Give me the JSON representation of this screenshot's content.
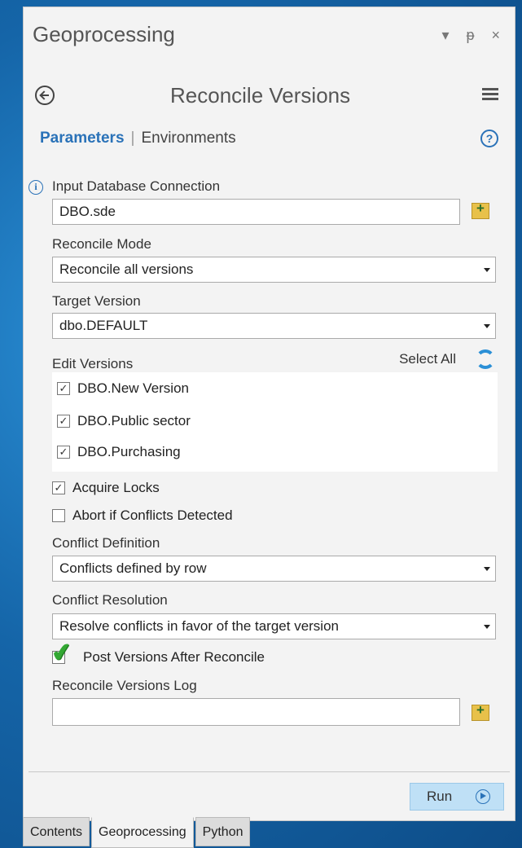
{
  "header": {
    "title": "Geoprocessing",
    "controls": "▾ ᵽ ×"
  },
  "tool": {
    "title": "Reconcile Versions"
  },
  "tabs": {
    "parameters": "Parameters",
    "separator": "|",
    "environments": "Environments"
  },
  "help_glyph": "?",
  "info_glyph": "i",
  "params": {
    "input_db": {
      "label": "Input Database Connection",
      "value": "DBO.sde"
    },
    "reconcile_mode": {
      "label": "Reconcile Mode",
      "value": "Reconcile all versions"
    },
    "target_version": {
      "label": "Target Version",
      "value": "dbo.DEFAULT"
    },
    "edit_versions": {
      "label": "Edit Versions",
      "select_all": "Select All",
      "items": [
        {
          "label": "DBO.New Version",
          "checked": "✓"
        },
        {
          "label": "DBO.Public sector",
          "checked": "✓"
        },
        {
          "label": "DBO.Purchasing",
          "checked": "✓"
        }
      ]
    },
    "acquire_locks": {
      "label": "Acquire Locks",
      "checked": "✓"
    },
    "abort_conflicts": {
      "label": "Abort if Conflicts Detected",
      "checked": ""
    },
    "conflict_definition": {
      "label": "Conflict Definition",
      "value": "Conflicts defined by row"
    },
    "conflict_resolution": {
      "label": "Conflict Resolution",
      "value": "Resolve conflicts in favor of the target version"
    },
    "post_versions": {
      "label": "Post Versions After Reconcile",
      "checked": "✔"
    },
    "log": {
      "label": "Reconcile Versions Log",
      "value": ""
    }
  },
  "run_label": "Run",
  "bottom_tabs": [
    "Contents",
    "Geoprocessing",
    "Python"
  ],
  "colors": {
    "accent": "#2a72b8",
    "run_bg": "#bfe0f6",
    "check_green": "#33a833"
  }
}
